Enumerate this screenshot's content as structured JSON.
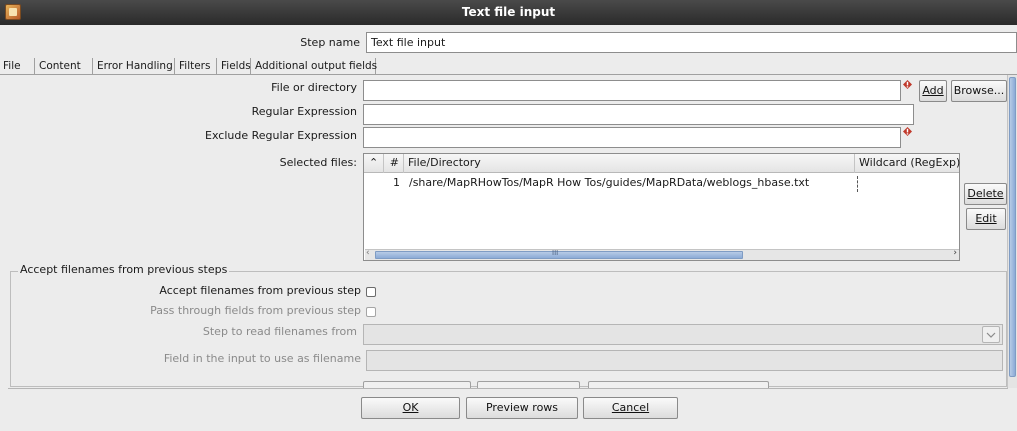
{
  "window": {
    "title": "Text file input"
  },
  "step": {
    "label": "Step name",
    "value": "Text file input"
  },
  "tabs": [
    {
      "label": "File",
      "active": true
    },
    {
      "label": "Content"
    },
    {
      "label": "Error Handling"
    },
    {
      "label": "Filters"
    },
    {
      "label": "Fields"
    },
    {
      "label": "Additional output fields"
    }
  ],
  "file": {
    "file_or_directory_label": "File or directory",
    "file_or_directory_value": "",
    "add_button": "Add",
    "browse_button": "Browse...",
    "regex_label": "Regular Expression",
    "regex_value": "",
    "exclude_regex_label": "Exclude Regular Expression",
    "exclude_regex_value": "",
    "selected_files_label": "Selected files:",
    "table": {
      "columns": [
        "#",
        "File/Directory",
        "Wildcard (RegExp)"
      ],
      "rows": [
        {
          "num": "1",
          "path": "/share/MapRHowTos/MapR How Tos/guides/MapRData/weblogs_hbase.txt",
          "wildcard": ""
        }
      ],
      "scroll_mark": "III"
    },
    "delete_button": "Delete",
    "edit_button": "Edit"
  },
  "prev_steps": {
    "legend": "Accept filenames from previous steps",
    "accept_label": "Accept filenames from previous step",
    "pass_through_label": "Pass through fields from previous step",
    "step_to_read_label": "Step to read filenames from",
    "step_to_read_value": "",
    "field_label": "Field in the input to use as filename",
    "field_value": ""
  },
  "footer": {
    "ok": "OK",
    "preview": "Preview rows",
    "cancel": "Cancel"
  },
  "colors": {
    "warning_diamond": "#c0392b",
    "scroll_thumb": "#8cabd6"
  }
}
